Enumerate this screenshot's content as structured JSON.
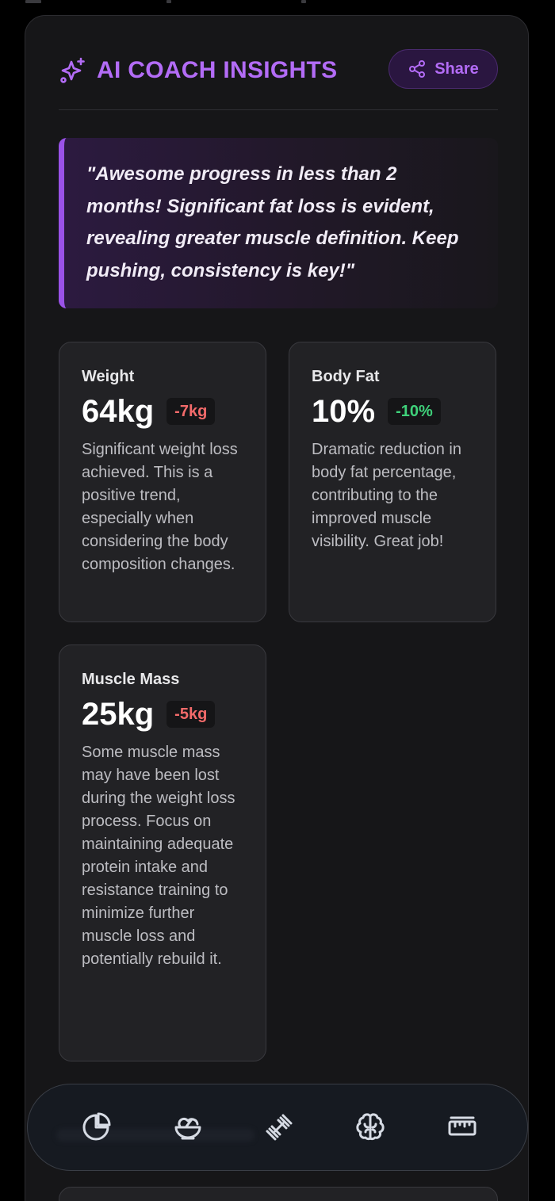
{
  "header": {
    "title": "AI COACH INSIGHTS",
    "share_label": "Share",
    "icon": "sparkles-icon"
  },
  "coach_quote": "\"Awesome progress in less than 2 months! Significant fat loss is evident, revealing greater muscle definition. Keep pushing, consistency is key!\"",
  "metrics": [
    {
      "label": "Weight",
      "value": "64kg",
      "change": "-7kg",
      "change_tone": "negative",
      "description": "Significant weight loss achieved. This is a positive trend, especially when considering the body composition changes."
    },
    {
      "label": "Body Fat",
      "value": "10%",
      "change": "-10%",
      "change_tone": "positive",
      "description": "Dramatic reduction in body fat percentage, contributing to the improved muscle visibility. Great job!"
    },
    {
      "label": "Muscle Mass",
      "value": "25kg",
      "change": "-5kg",
      "change_tone": "negative",
      "description": "Some muscle mass may have been lost during the weight loss process. Focus on maintaining adequate protein intake and resistance training to minimize further muscle loss and potentially rebuild it."
    }
  ],
  "bottom_nav": {
    "items": [
      {
        "icon": "pie-chart-icon"
      },
      {
        "icon": "salad-bowl-icon"
      },
      {
        "icon": "dumbbell-icon"
      },
      {
        "icon": "brain-icon"
      },
      {
        "icon": "ruler-icon"
      }
    ]
  },
  "colors": {
    "accent": "#b36cf6",
    "negative": "#f26a6a",
    "positive": "#3fd17a",
    "card_bg": "#161618"
  }
}
